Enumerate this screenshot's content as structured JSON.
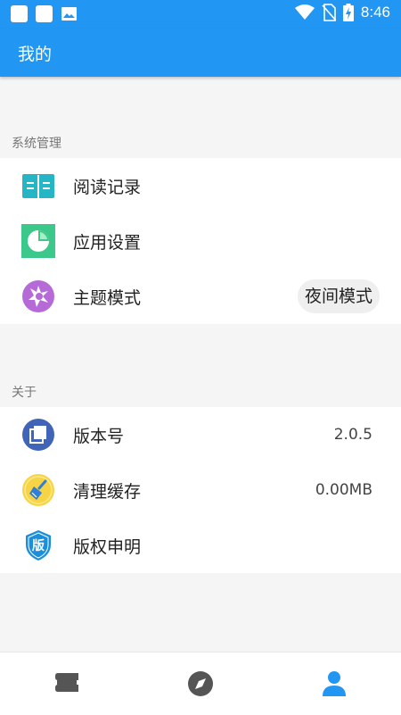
{
  "status_bar": {
    "time": "8:46"
  },
  "app_bar": {
    "title": "我的"
  },
  "sections": {
    "management": {
      "header": "系统管理",
      "items": [
        {
          "label": "阅读记录",
          "icon": "book-icon"
        },
        {
          "label": "应用设置",
          "icon": "pie-chart-icon"
        },
        {
          "label": "主题模式",
          "icon": "theme-icon",
          "action_label": "夜间模式"
        }
      ]
    },
    "about": {
      "header": "关于",
      "items": [
        {
          "label": "版本号",
          "icon": "version-icon",
          "value": "2.0.5"
        },
        {
          "label": "清理缓存",
          "icon": "broom-icon",
          "value": "0.00MB"
        },
        {
          "label": "版权申明",
          "icon": "copyright-shield-icon",
          "badge": "版"
        }
      ]
    }
  },
  "bottom_nav": {
    "items": [
      {
        "icon": "bookshelf-icon",
        "active": false
      },
      {
        "icon": "compass-icon",
        "active": false
      },
      {
        "icon": "user-icon",
        "active": true
      }
    ]
  },
  "colors": {
    "primary": "#2196f3",
    "book_icon": "#26b5c4",
    "settings_icon": "#3cc88a",
    "theme_icon": "#b56ad8",
    "version_icon": "#3f64b8",
    "broom_icon": "#f6d445",
    "copyright_icon": "#1a8fdc"
  }
}
